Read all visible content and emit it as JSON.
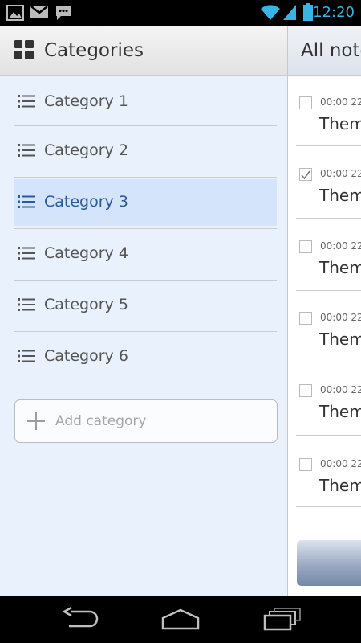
{
  "status_bar": {
    "time": "12:20",
    "icons": [
      "picture-icon",
      "gmail-icon",
      "chat-icon",
      "wifi-icon",
      "signal-icon",
      "battery-icon"
    ]
  },
  "sidebar": {
    "title": "Categories",
    "items": [
      {
        "label": "Category 1",
        "selected": false
      },
      {
        "label": "Category 2",
        "selected": false
      },
      {
        "label": "Category 3",
        "selected": true
      },
      {
        "label": "Category 4",
        "selected": false
      },
      {
        "label": "Category 5",
        "selected": false
      },
      {
        "label": "Category 6",
        "selected": false
      }
    ],
    "add_placeholder": "Add category"
  },
  "notes_panel": {
    "title": "All note",
    "notes": [
      {
        "time": "00:00 22",
        "title": "Them",
        "checked": false
      },
      {
        "time": "00:00 22",
        "title": "Them",
        "checked": true
      },
      {
        "time": "00:00 22",
        "title": "Them",
        "checked": false
      },
      {
        "time": "00:00 22",
        "title": "Them",
        "checked": false
      },
      {
        "time": "00:00 22",
        "title": "Them",
        "checked": false
      },
      {
        "time": "00:00 22",
        "title": "Them",
        "checked": false
      }
    ]
  },
  "colors": {
    "accent": "#39b4e6",
    "selected_bg": "#d4e4fb",
    "selected_text": "#2a5a9e",
    "panel_bg": "#e9f1fd"
  },
  "navigation": {
    "buttons": [
      "back-icon",
      "home-icon",
      "recent-apps-icon"
    ]
  }
}
